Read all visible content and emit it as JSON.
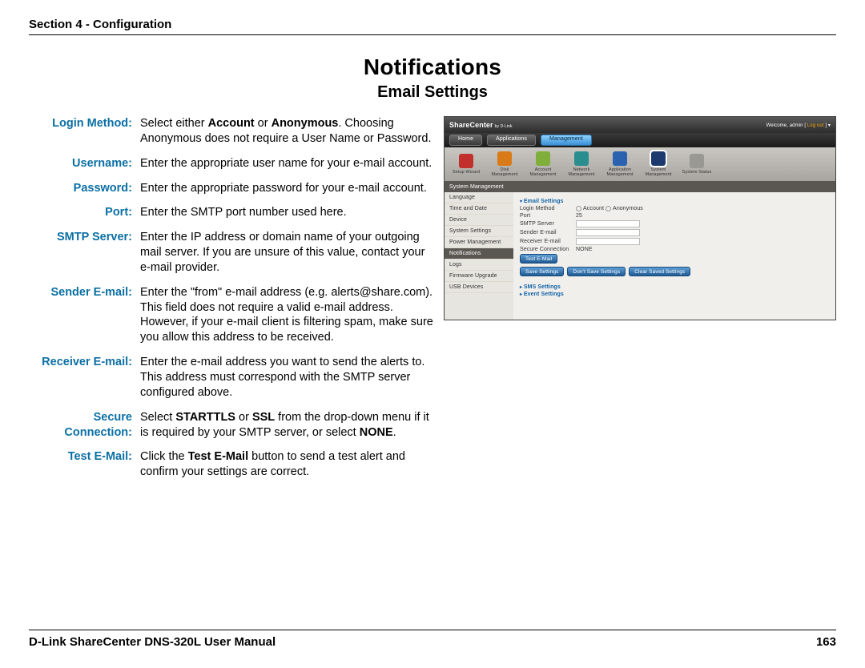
{
  "header": {
    "section": "Section 4 - Configuration"
  },
  "title": "Notifications",
  "subtitle": "Email Settings",
  "defs": {
    "login_method": {
      "label": "Login Method:",
      "desc_pre": "Select either ",
      "b1": "Account",
      "mid": " or ",
      "b2": "Anonymous",
      "desc_post": ". Choosing Anonymous does not require a User Name or Password."
    },
    "username": {
      "label": "Username:",
      "desc": "Enter the appropriate user name for your e-mail account."
    },
    "password": {
      "label": "Password:",
      "desc": "Enter the appropriate password for your e-mail account."
    },
    "port": {
      "label": "Port:",
      "desc": "Enter the SMTP port number used here."
    },
    "smtp": {
      "label": "SMTP Server:",
      "desc": "Enter the IP address or domain name of your outgoing mail server. If you are unsure of this value, contact your e-mail provider."
    },
    "sender": {
      "label": "Sender E-mail:",
      "desc": "Enter the \"from\" e-mail address (e.g. alerts@share.com). This field does not require a valid e-mail address. However, if your e-mail client is filtering spam, make sure you allow this address to be received."
    },
    "receiver": {
      "label": "Receiver E-mail:",
      "desc": "Enter the e-mail address you want to send the alerts to. This address must correspond with the SMTP server configured above."
    },
    "secure": {
      "label_l1": "Secure",
      "label_l2": "Connection:",
      "desc_pre": "Select ",
      "b1": "STARTTLS",
      "mid1": " or ",
      "b2": "SSL",
      "mid2": " from the drop-down menu if it is required by your SMTP server, or select ",
      "b3": "NONE",
      "post": "."
    },
    "test": {
      "label": "Test E-Mail:",
      "desc_pre": "Click the ",
      "b1": "Test E-Mail",
      "desc_post": " button to send a test alert and confirm your settings are correct."
    }
  },
  "screenshot": {
    "logo": "ShareCenter",
    "logo_sub": "by D-Link",
    "welcome_pre": "Welcome, admin [ ",
    "welcome_link": "Log out",
    "welcome_post": " ] ▾",
    "tabs": {
      "t1": "Home",
      "t2": "Applications",
      "t3": "Management"
    },
    "icons": {
      "i1": "Setup Wizard",
      "i2": "Disk Management",
      "i3": "Account Management",
      "i4": "Network Management",
      "i5": "Application Management",
      "i6": "System Management",
      "i7": "System Status"
    },
    "panel_header": "System Management",
    "sidebar": {
      "s1": "Language",
      "s2": "Time and Date",
      "s3": "Device",
      "s4": "System Settings",
      "s5": "Power Management",
      "s6": "Notifications",
      "s7": "Logs",
      "s8": "Firmware Upgrade",
      "s9": "USB Devices"
    },
    "main": {
      "sec1": "Email Settings",
      "login_method_k": "Login Method",
      "login_method_a": "Account",
      "login_method_b": "Anonymous",
      "port_k": "Port",
      "port_v": "25",
      "smtp_k": "SMTP Server",
      "sender_k": "Sender E-mail",
      "receiver_k": "Receiver E-mail",
      "secure_k": "Secure Connection",
      "secure_v": "NONE",
      "test_btn": "Test E-Mail",
      "btn1": "Save Settings",
      "btn2": "Don't Save Settings",
      "btn3": "Clear Saved Settings",
      "sec2": "SMS Settings",
      "sec3": "Event Settings"
    }
  },
  "footer": {
    "manual": "D-Link ShareCenter DNS-320L User Manual",
    "page": "163"
  }
}
